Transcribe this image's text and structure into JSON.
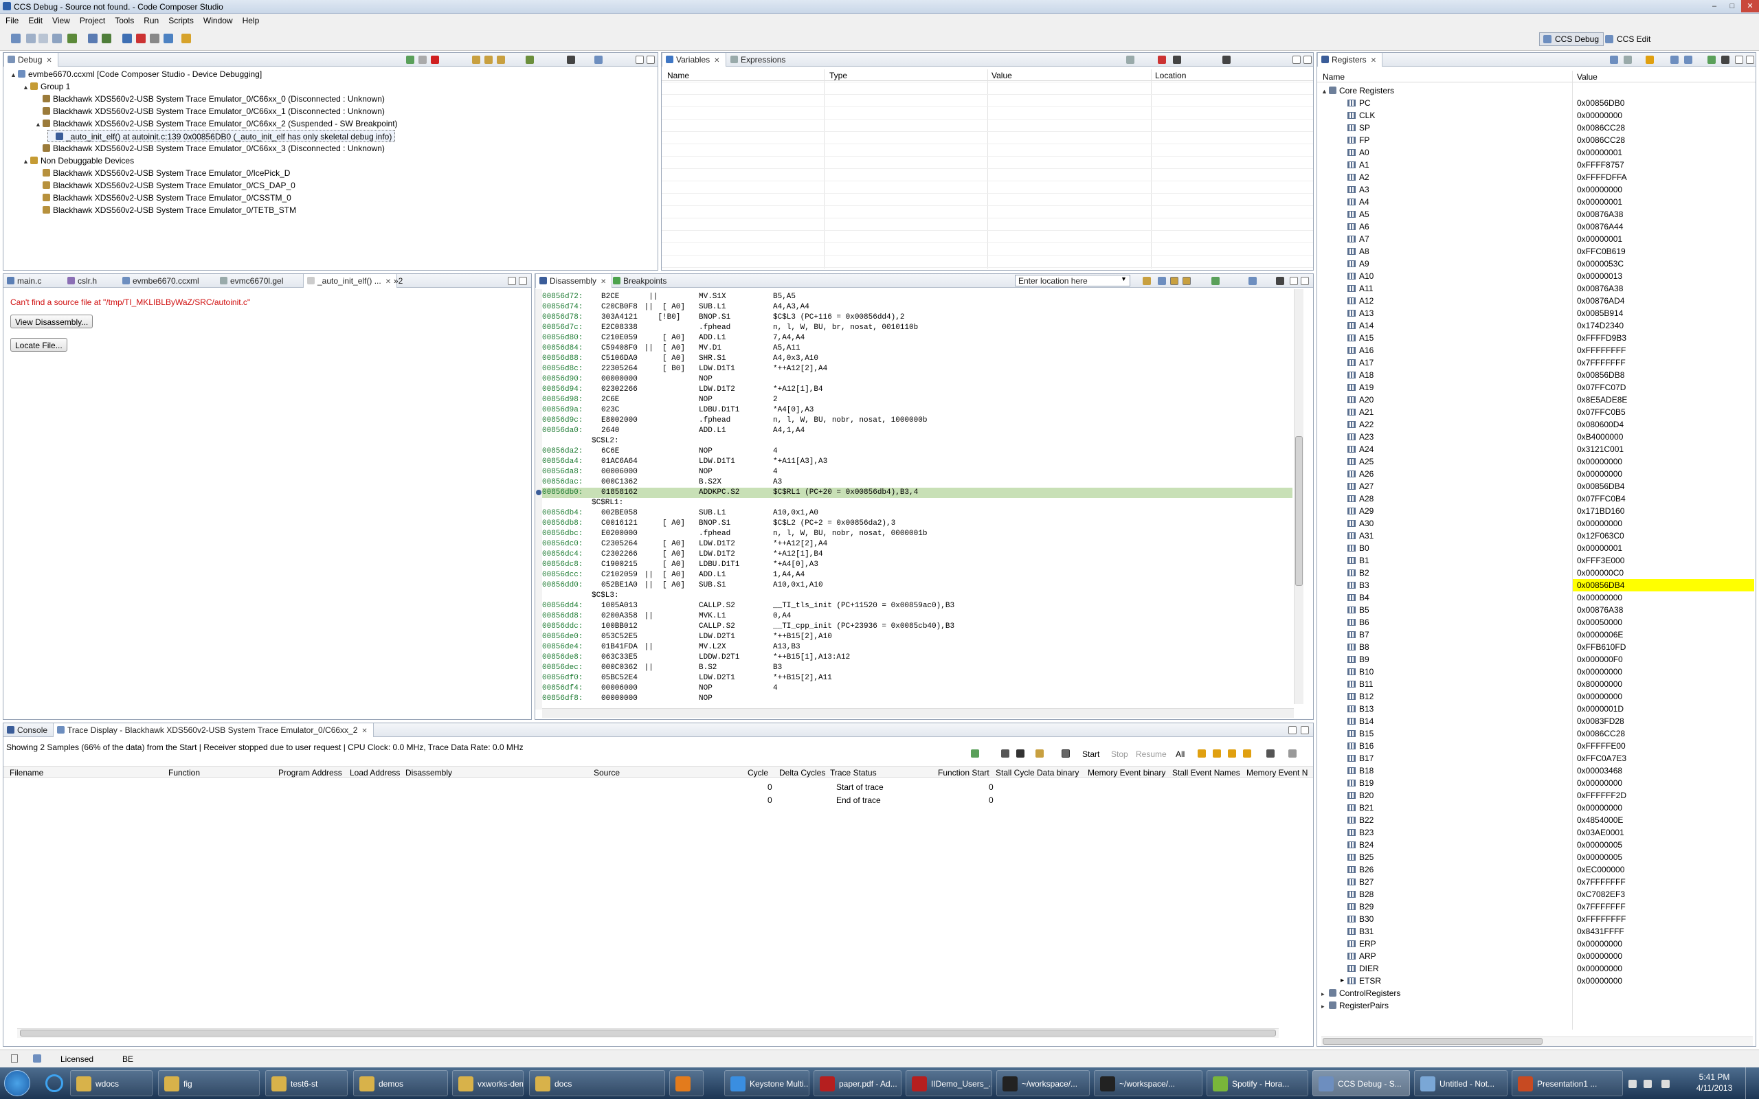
{
  "window": {
    "title": "CCS Debug - Source not found. - Code Composer Studio",
    "controls": [
      "–",
      "□",
      "✕"
    ]
  },
  "menu": [
    "File",
    "Edit",
    "View",
    "Project",
    "Tools",
    "Run",
    "Scripts",
    "Window",
    "Help"
  ],
  "perspectives": [
    "CCS Debug",
    "CCS Edit"
  ],
  "debug": {
    "tab": "Debug",
    "items": [
      {
        "text": "evmbe6670.ccxml [Code Composer Studio - Device Debugging]",
        "indent": 0,
        "exp": "▲",
        "icon": "#6d8ebf"
      },
      {
        "text": "Group 1",
        "indent": 1,
        "exp": "▲",
        "icon": "#c59b34"
      },
      {
        "text": "Blackhawk XDS560v2-USB System Trace Emulator_0/C66xx_0 (Disconnected : Unknown)",
        "indent": 2,
        "exp": "",
        "icon": "#9b7b3a"
      },
      {
        "text": "Blackhawk XDS560v2-USB System Trace Emulator_0/C66xx_1 (Disconnected : Unknown)",
        "indent": 2,
        "exp": "",
        "icon": "#9b7b3a"
      },
      {
        "text": "Blackhawk XDS560v2-USB System Trace Emulator_0/C66xx_2 (Suspended - SW Breakpoint)",
        "indent": 2,
        "exp": "▲",
        "icon": "#9b7b3a"
      },
      {
        "text": "_auto_init_elf() at autoinit.c:139 0x00856DB0  (_auto_init_elf has only skeletal debug info)",
        "indent": 3,
        "exp": "",
        "icon": "#3b5d99",
        "selected": true
      },
      {
        "text": "Blackhawk XDS560v2-USB System Trace Emulator_0/C66xx_3 (Disconnected : Unknown)",
        "indent": 2,
        "exp": "",
        "icon": "#9b7b3a"
      },
      {
        "text": "Non Debuggable Devices",
        "indent": 1,
        "exp": "▲",
        "icon": "#c59b34"
      },
      {
        "text": "Blackhawk XDS560v2-USB System Trace Emulator_0/IcePick_D",
        "indent": 2,
        "exp": "",
        "icon": "#b7913d"
      },
      {
        "text": "Blackhawk XDS560v2-USB System Trace Emulator_0/CS_DAP_0",
        "indent": 2,
        "exp": "",
        "icon": "#b7913d"
      },
      {
        "text": "Blackhawk XDS560v2-USB System Trace Emulator_0/CSSTM_0",
        "indent": 2,
        "exp": "",
        "icon": "#b7913d"
      },
      {
        "text": "Blackhawk XDS560v2-USB System Trace Emulator_0/TETB_STM",
        "indent": 2,
        "exp": "",
        "icon": "#b7913d"
      }
    ]
  },
  "variables": {
    "tabs": [
      "Variables",
      "Expressions"
    ],
    "columns": [
      "Name",
      "Type",
      "Value",
      "Location"
    ]
  },
  "editor": {
    "tabs": [
      "main.c",
      "cslr.h",
      "evmbe6670.ccxml",
      "evmc6670l.gel",
      "_auto_init_elf() ...",
      "»2"
    ],
    "error": "Can't find a source file at \"/tmp/TI_MKLIBLByWaZ/SRC/autoinit.c\"",
    "view_button": "View Disassembly...",
    "locate_button": "Locate File..."
  },
  "disassembly": {
    "tabs": [
      "Disassembly",
      "Breakpoints"
    ],
    "location_placeholder": "Enter location here",
    "lines": [
      {
        "a": "00856d72:",
        "o": "B2CE",
        "p": "  ||",
        "i": "MV.S1X",
        "r": "B5,A5"
      },
      {
        "a": "00856d74:",
        "o": "C20CB0F8",
        "p": " ||  [ A0]",
        "i": "SUB.L1",
        "r": "A4,A3,A4"
      },
      {
        "a": "00856d78:",
        "o": "303A4121",
        "p": "    [!B0]",
        "i": "BNOP.S1",
        "r": "$C$L3 (PC+116 = 0x00856dd4),2"
      },
      {
        "a": "00856d7c:",
        "o": "E2C08338",
        "p": "",
        "i": ".fphead",
        "r": "n, l, W, BU, br, nosat, 0010110b"
      },
      {
        "a": "00856d80:",
        "o": "C210E059",
        "p": "     [ A0]",
        "i": "ADD.L1",
        "r": "7,A4,A4"
      },
      {
        "a": "00856d84:",
        "o": "C59408F0",
        "p": " ||  [ A0]",
        "i": "MV.D1",
        "r": "A5,A11"
      },
      {
        "a": "00856d88:",
        "o": "C5106DA0",
        "p": "     [ A0]",
        "i": "SHR.S1",
        "r": "A4,0x3,A10"
      },
      {
        "a": "00856d8c:",
        "o": "22305264",
        "p": "     [ B0]",
        "i": "LDW.D1T1",
        "r": "*++A12[2],A4"
      },
      {
        "a": "00856d90:",
        "o": "00000000",
        "p": "",
        "i": "NOP",
        "r": ""
      },
      {
        "a": "00856d94:",
        "o": "02302266",
        "p": "",
        "i": "LDW.D1T2",
        "r": "*+A12[1],B4"
      },
      {
        "a": "00856d98:",
        "o": "2C6E",
        "p": "",
        "i": "NOP",
        "r": "2"
      },
      {
        "a": "00856d9a:",
        "o": "023C",
        "p": "",
        "i": "LDBU.D1T1",
        "r": "*A4[0],A3"
      },
      {
        "a": "00856d9c:",
        "o": "E8002000",
        "p": "",
        "i": ".fphead",
        "r": "n, l, W, BU, nobr, nosat, 1000000b"
      },
      {
        "a": "00856da0:",
        "o": "2640",
        "p": "",
        "i": "ADD.L1",
        "r": "A4,1,A4"
      },
      {
        "label": "$C$L2:"
      },
      {
        "a": "00856da2:",
        "o": "6C6E",
        "p": "",
        "i": "NOP",
        "r": "4"
      },
      {
        "a": "00856da4:",
        "o": "01AC6A64",
        "p": "",
        "i": "LDW.D1T1",
        "r": "*+A11[A3],A3"
      },
      {
        "a": "00856da8:",
        "o": "00006000",
        "p": "",
        "i": "NOP",
        "r": "4"
      },
      {
        "a": "00856dac:",
        "o": "000C1362",
        "p": "",
        "i": "B.S2X",
        "r": "A3"
      },
      {
        "a": "00856db0:",
        "o": "01858162",
        "p": "",
        "i": "ADDKPC.S2",
        "r": "$C$RL1 (PC+20 = 0x00856db4),B3,4",
        "hl": true
      },
      {
        "label": "$C$RL1:"
      },
      {
        "a": "00856db4:",
        "o": "002BE058",
        "p": "",
        "i": "SUB.L1",
        "r": "A10,0x1,A0"
      },
      {
        "a": "00856db8:",
        "o": "C0016121",
        "p": "     [ A0]",
        "i": "BNOP.S1",
        "r": "$C$L2 (PC+2 = 0x00856da2),3"
      },
      {
        "a": "00856dbc:",
        "o": "E0200000",
        "p": "",
        "i": ".fphead",
        "r": "n, l, W, BU, nobr, nosat, 0000001b"
      },
      {
        "a": "00856dc0:",
        "o": "C2305264",
        "p": "     [ A0]",
        "i": "LDW.D1T2",
        "r": "*++A12[2],A4"
      },
      {
        "a": "00856dc4:",
        "o": "C2302266",
        "p": "     [ A0]",
        "i": "LDW.D1T2",
        "r": "*+A12[1],B4"
      },
      {
        "a": "00856dc8:",
        "o": "C1900215",
        "p": "     [ A0]",
        "i": "LDBU.D1T1",
        "r": "*+A4[0],A3"
      },
      {
        "a": "00856dcc:",
        "o": "C2102059",
        "p": " ||  [ A0]",
        "i": "ADD.L1",
        "r": "1,A4,A4"
      },
      {
        "a": "00856dd0:",
        "o": "052BE1A0",
        "p": " ||  [ A0]",
        "i": "SUB.S1",
        "r": "A10,0x1,A10"
      },
      {
        "label": "$C$L3:"
      },
      {
        "a": "00856dd4:",
        "o": "1005A013",
        "p": "",
        "i": "CALLP.S2",
        "r": "__TI_tls_init (PC+11520 = 0x00859ac0),B3"
      },
      {
        "a": "00856dd8:",
        "o": "0200A358",
        "p": " ||",
        "i": "MVK.L1",
        "r": "0,A4"
      },
      {
        "a": "00856ddc:",
        "o": "100BB012",
        "p": "",
        "i": "CALLP.S2",
        "r": "__TI_cpp_init (PC+23936 = 0x0085cb40),B3"
      },
      {
        "a": "00856de0:",
        "o": "053C52E5",
        "p": "",
        "i": "LDW.D2T1",
        "r": "*++B15[2],A10"
      },
      {
        "a": "00856de4:",
        "o": "01B41FDA",
        "p": " ||",
        "i": "MV.L2X",
        "r": "A13,B3"
      },
      {
        "a": "00856de8:",
        "o": "063C33E5",
        "p": "",
        "i": "LDDW.D2T1",
        "r": "*++B15[1],A13:A12"
      },
      {
        "a": "00856dec:",
        "o": "000C0362",
        "p": " ||",
        "i": "B.S2",
        "r": "B3"
      },
      {
        "a": "00856df0:",
        "o": "05BC52E4",
        "p": "",
        "i": "LDW.D2T1",
        "r": "*++B15[2],A11"
      },
      {
        "a": "00856df4:",
        "o": "00006000",
        "p": "",
        "i": "NOP",
        "r": "4"
      },
      {
        "a": "00856df8:",
        "o": "00000000",
        "p": "",
        "i": "NOP",
        "r": ""
      }
    ]
  },
  "console": {
    "tabs": [
      "Console",
      "Trace Display - Blackhawk XDS560v2-USB System Trace Emulator_0/C66xx_2"
    ],
    "status": "Showing 2 Samples (66% of the data) from the Start  |  Receiver stopped due to user request  |  CPU Clock: 0.0 MHz, Trace Data Rate: 0.0 MHz",
    "buttons": [
      "Start",
      "Stop",
      "Resume",
      "All"
    ],
    "columns": [
      "Filename",
      "Function",
      "Program Address",
      "Load Address",
      "Disassembly",
      "Source",
      "Cycle",
      "Delta Cycles",
      "Trace Status",
      "Function Start",
      "Stall Cycle Data binary",
      "Memory Event binary",
      "Stall Event Names",
      "Memory Event N"
    ],
    "rows": [
      {
        "cycle": "0",
        "status": "Start of trace",
        "fstart": "0"
      },
      {
        "cycle": "0",
        "status": "End of trace",
        "fstart": "0"
      }
    ]
  },
  "registers": {
    "tab": "Registers",
    "columns": [
      "Name",
      "Value"
    ],
    "group": "Core Registers",
    "list": [
      [
        "PC",
        "0x00856DB0"
      ],
      [
        "CLK",
        "0x00000000"
      ],
      [
        "SP",
        "0x0086CC28"
      ],
      [
        "FP",
        "0x0086CC28"
      ],
      [
        "A0",
        "0x00000001"
      ],
      [
        "A1",
        "0xFFFF8757"
      ],
      [
        "A2",
        "0xFFFFDFFA"
      ],
      [
        "A3",
        "0x00000000"
      ],
      [
        "A4",
        "0x00000001"
      ],
      [
        "A5",
        "0x00876A38"
      ],
      [
        "A6",
        "0x00876A44"
      ],
      [
        "A7",
        "0x00000001"
      ],
      [
        "A8",
        "0xFFC0B619"
      ],
      [
        "A9",
        "0x0000053C"
      ],
      [
        "A10",
        "0x00000013"
      ],
      [
        "A11",
        "0x00876A38"
      ],
      [
        "A12",
        "0x00876AD4"
      ],
      [
        "A13",
        "0x0085B914"
      ],
      [
        "A14",
        "0x174D2340"
      ],
      [
        "A15",
        "0xFFFFD9B3"
      ],
      [
        "A16",
        "0xFFFFFFFF"
      ],
      [
        "A17",
        "0x7FFFFFFF"
      ],
      [
        "A18",
        "0x00856DB8"
      ],
      [
        "A19",
        "0x07FFC07D"
      ],
      [
        "A20",
        "0x8E5ADE8E"
      ],
      [
        "A21",
        "0x07FFC0B5"
      ],
      [
        "A22",
        "0x080600D4"
      ],
      [
        "A23",
        "0xB4000000"
      ],
      [
        "A24",
        "0x3121C001"
      ],
      [
        "A25",
        "0x00000000"
      ],
      [
        "A26",
        "0x00000000"
      ],
      [
        "A27",
        "0x00856DB4"
      ],
      [
        "A28",
        "0x07FFC0B4"
      ],
      [
        "A29",
        "0x171BD160"
      ],
      [
        "A30",
        "0x00000000"
      ],
      [
        "A31",
        "0x12F063C0"
      ],
      [
        "B0",
        "0x00000001"
      ],
      [
        "B1",
        "0xFFF3E000"
      ],
      [
        "B2",
        "0x000000C0"
      ],
      [
        "B3",
        "0x00856DB4"
      ],
      [
        "B4",
        "0x00000000"
      ],
      [
        "B5",
        "0x00876A38"
      ],
      [
        "B6",
        "0x00050000"
      ],
      [
        "B7",
        "0x0000006E"
      ],
      [
        "B8",
        "0xFFB610FD"
      ],
      [
        "B9",
        "0x000000F0"
      ],
      [
        "B10",
        "0x00000000"
      ],
      [
        "B11",
        "0x80000000"
      ],
      [
        "B12",
        "0x00000000"
      ],
      [
        "B13",
        "0x0000001D"
      ],
      [
        "B14",
        "0x0083FD28"
      ],
      [
        "B15",
        "0x0086CC28"
      ],
      [
        "B16",
        "0xFFFFFE00"
      ],
      [
        "B17",
        "0xFFC0A7E3"
      ],
      [
        "B18",
        "0x00003468"
      ],
      [
        "B19",
        "0x00000000"
      ],
      [
        "B20",
        "0xFFFFFF2D"
      ],
      [
        "B21",
        "0x00000000"
      ],
      [
        "B22",
        "0x4854000E"
      ],
      [
        "B23",
        "0x03AE0001"
      ],
      [
        "B24",
        "0x00000005"
      ],
      [
        "B25",
        "0x00000005"
      ],
      [
        "B26",
        "0xEC000000"
      ],
      [
        "B27",
        "0x7FFFFFFF"
      ],
      [
        "B28",
        "0xC7082EF3"
      ],
      [
        "B29",
        "0x7FFFFFFF"
      ],
      [
        "B30",
        "0xFFFFFFFF"
      ],
      [
        "B31",
        "0x8431FFFF"
      ],
      [
        "ERP",
        "0x00000000"
      ],
      [
        "ARP",
        "0x00000000"
      ],
      [
        "DIER",
        "0x00000000"
      ],
      [
        "ETSR",
        "0x00000000"
      ]
    ],
    "highlight": "B3",
    "highlight_color": "#ffff00",
    "subgroups": [
      "ControlRegisters",
      "RegisterPairs"
    ]
  },
  "statusbar": {
    "license": "Licensed",
    "mode": "BE"
  },
  "taskbar": {
    "items": [
      {
        "label": "wdocs",
        "color": "#d8b24a"
      },
      {
        "label": "fig",
        "color": "#d8b24a"
      },
      {
        "label": "test6-st",
        "color": "#d8b24a"
      },
      {
        "label": "demos",
        "color": "#d8b24a"
      },
      {
        "label": "vxworks-demo",
        "color": "#d8b24a"
      },
      {
        "label": "docs",
        "color": "#d8b24a"
      },
      {
        "label": "",
        "color": "#e37b1c"
      },
      {
        "label": "Keystone Multi...",
        "color": "#3a8ee0"
      },
      {
        "label": "paper.pdf - Ad...",
        "color": "#b51f1f"
      },
      {
        "label": "IIDemo_Users_...",
        "color": "#b51f1f"
      },
      {
        "label": "~/workspace/...",
        "color": "#222"
      },
      {
        "label": "~/workspace/...",
        "color": "#222"
      },
      {
        "label": "Spotify - Hora...",
        "color": "#79b63a"
      },
      {
        "label": "CCS Debug - S...",
        "color": "#6d8ebf"
      },
      {
        "label": "Untitled - Not...",
        "color": "#7aa7d6"
      },
      {
        "label": "Presentation1 ...",
        "color": "#c74a22"
      }
    ],
    "time": "5:41 PM",
    "date": "4/11/2013"
  }
}
